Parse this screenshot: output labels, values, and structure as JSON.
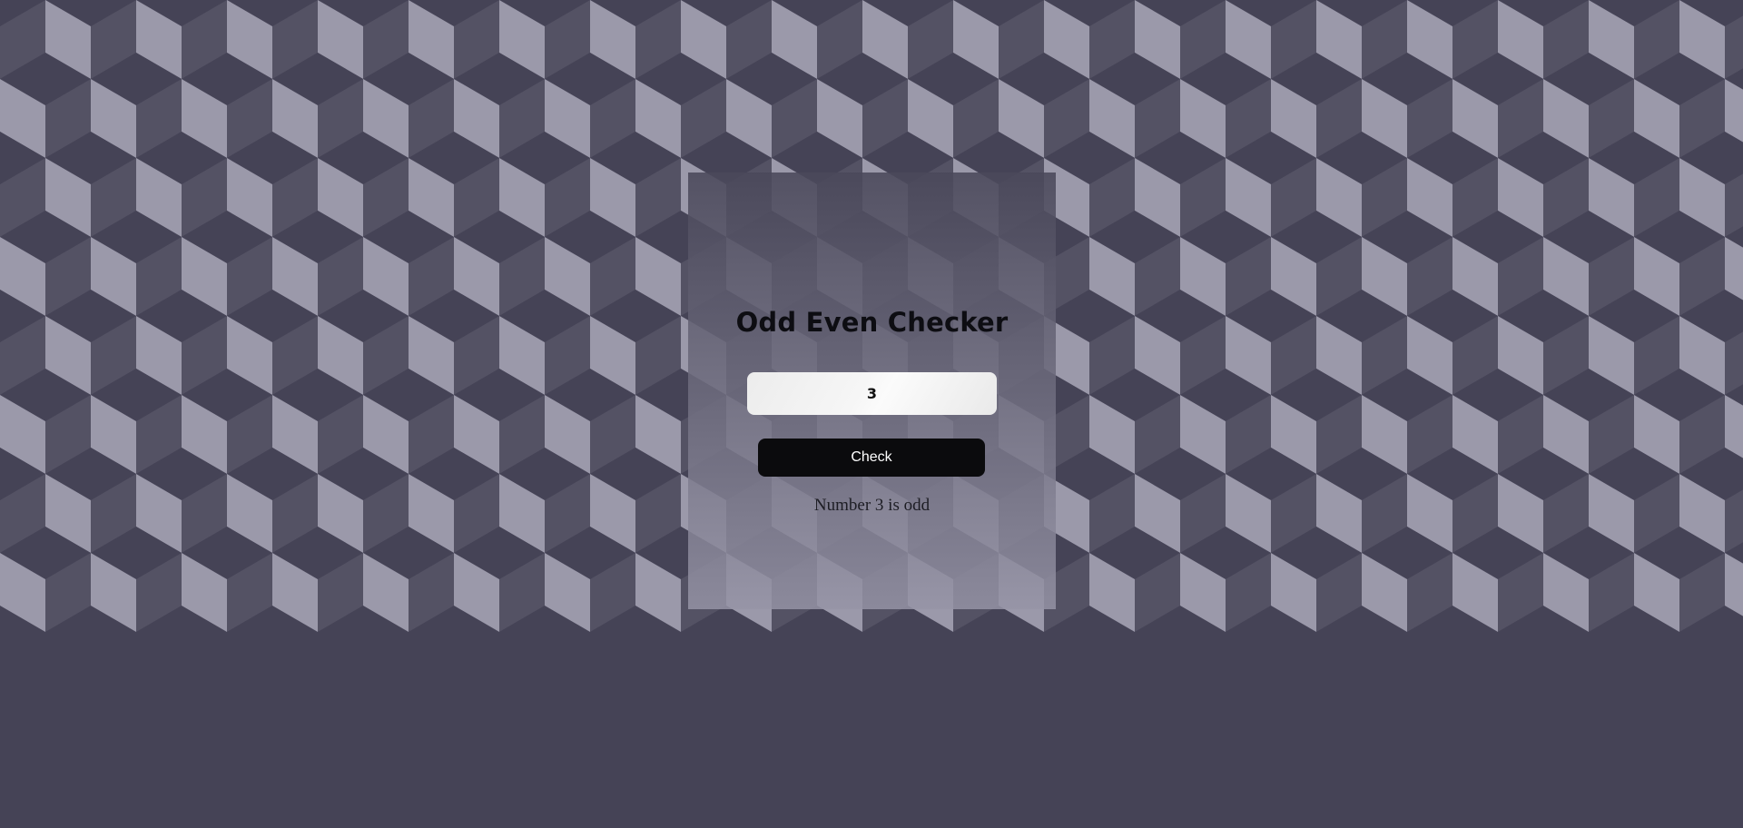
{
  "background": {
    "pattern": "isometric-cubes",
    "colors": {
      "light_face": "#9b99aa",
      "mid_face": "#545264",
      "dark_face": "#454356"
    }
  },
  "card": {
    "title": "Odd Even Checker",
    "number_input": {
      "value": "3",
      "placeholder": ""
    },
    "check_button_label": "Check",
    "result_text": "Number 3 is odd"
  }
}
